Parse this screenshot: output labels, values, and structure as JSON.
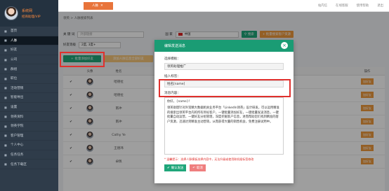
{
  "profile": {
    "name": "系统网",
    "role": "招商助理/VIP"
  },
  "sidebar": {
    "items": [
      {
        "label": "首页",
        "icon": "home-icon"
      },
      {
        "label": "人脉",
        "icon": "user-icon"
      },
      {
        "label": "好友",
        "icon": "users-icon"
      },
      {
        "label": "公司",
        "icon": "building-icon"
      },
      {
        "label": "群组",
        "icon": "group-icon"
      },
      {
        "label": "职位",
        "icon": "briefcase-icon"
      },
      {
        "label": "活动营销",
        "icon": "megaphone-icon"
      },
      {
        "label": "智能导出",
        "icon": "export-icon"
      },
      {
        "label": "设置",
        "icon": "gear-icon"
      },
      {
        "label": "领英资料",
        "icon": "linkedin-icon"
      },
      {
        "label": "领英学院",
        "icon": "school-icon"
      },
      {
        "label": "客户管理",
        "icon": "crm-icon"
      },
      {
        "label": "个人中心",
        "icon": "person-icon"
      },
      {
        "label": "任务任务",
        "icon": "task-icon"
      },
      {
        "label": "任务下载区",
        "icon": "download-icon"
      }
    ]
  },
  "topbar": {
    "tab_label": "人脉",
    "right_links": [
      "站内信",
      "在线客服",
      "使用帮助",
      "退出"
    ]
  },
  "breadcrumb": "领英 > 人脉搜索列表",
  "filters": {
    "keyword_label": "关 键 词",
    "keyword_placeholder": "外部链接",
    "country_label": "国 家",
    "country_value": "中国",
    "search_button": "搜索",
    "import_button": "+ 批量搜索客户资源",
    "friend_label": "好友等级",
    "friend_value": "2度, 3度+",
    "batch_add_button": "批量添加好友",
    "add_all_button": "添加人脉信息全部好友"
  },
  "table": {
    "headers": [
      "",
      "头像",
      "姓名",
      "操作"
    ],
    "rows": [
      {
        "name": "哈德拉",
        "action": "加好友"
      },
      {
        "name": "哈德拉",
        "action": "加好友"
      },
      {
        "name": "南冲",
        "action": "加好友"
      },
      {
        "name": "南冲",
        "action": "加好友"
      },
      {
        "name": "Cathy Ye",
        "action": "加好友"
      },
      {
        "name": "王德玮",
        "action": "加好友"
      },
      {
        "name": "卓佩",
        "action": "加好友"
      }
    ]
  },
  "modal": {
    "title": "编辑发送消息",
    "select_template_label": "选择模板：",
    "template_value": "领英助理推广",
    "insert_variable_label": "插入标签：",
    "variable_value": "姓名[name]",
    "content_label": "消息内容：",
    "content_greeting": "你好，{name}！",
    "content_body": "领英助理针对外贸精大数据相关业务平台「LinkedIn领英」设计研发，可以运用精准的搜索出领英平台内的所有目标客户，一键批量添加好友，一键批量发送消息，一键批量自动运营，一键好友分组管理，深度挖掘客户信息，进而帮助您们找到精准的客户资源，迅速达到精准主动营销，从而获得大量的销售机会，免费注册试用中。",
    "note": "* 温馨提示：选择人脉模板选择内容中，无法升级或使用联机插标签修改",
    "ok_button": "确认发送",
    "cancel_button": "取消"
  },
  "colors": {
    "accent_green": "#1a9c74",
    "accent_orange": "#e8743b",
    "highlight_red": "#e0302d",
    "sidebar_bg": "#2f3c4a"
  }
}
